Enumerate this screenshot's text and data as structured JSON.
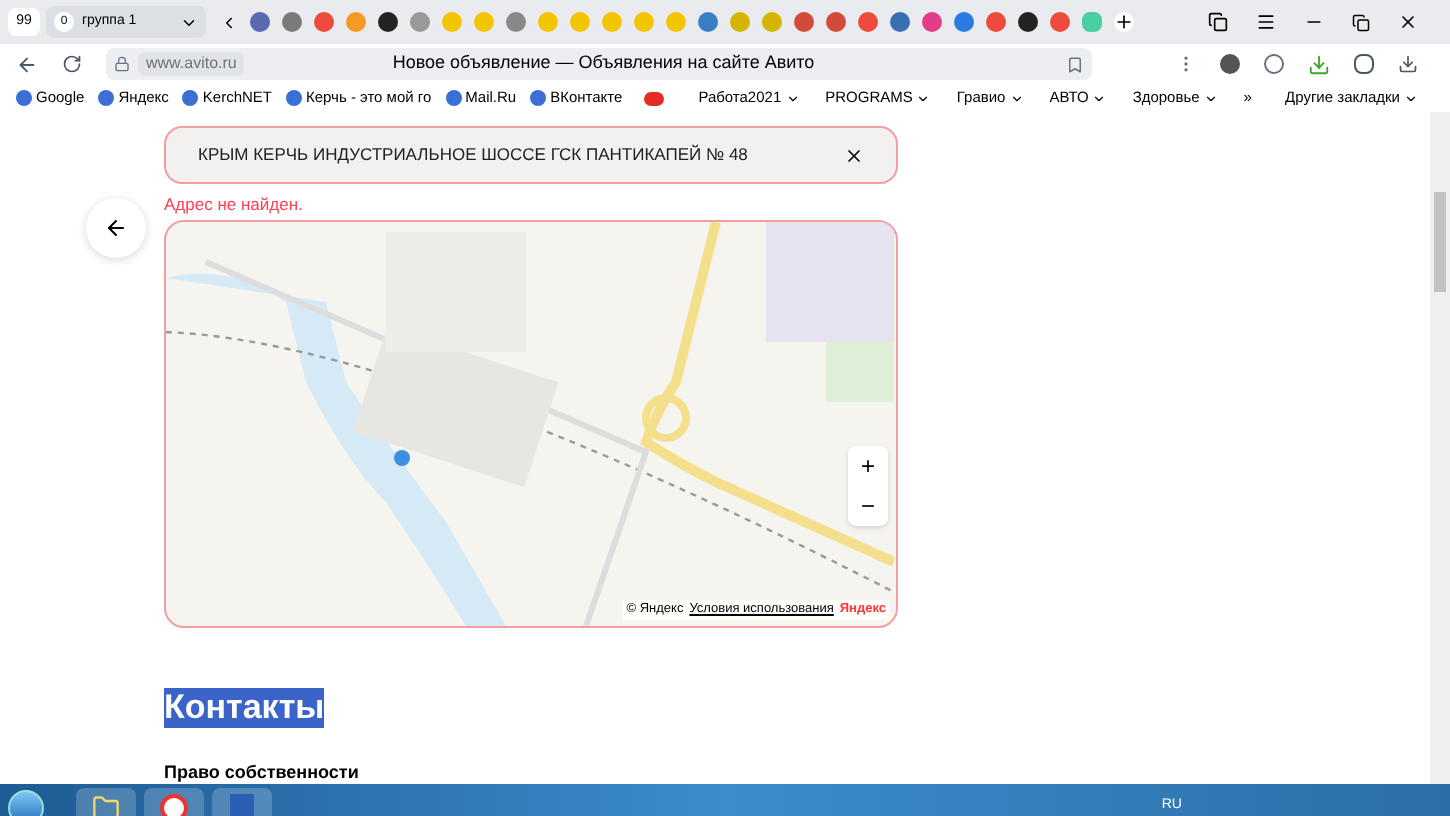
{
  "browser": {
    "tab_counter": "99",
    "tab_group": {
      "count": "0",
      "label": "группа 1"
    },
    "url": "www.avito.ru",
    "page_title": "Новое объявление — Объявления на сайте Авито"
  },
  "bookmarks": [
    {
      "label": "Google",
      "kind": "link"
    },
    {
      "label": "Яндекс",
      "kind": "link"
    },
    {
      "label": "KerchNET",
      "kind": "link"
    },
    {
      "label": "Керчь - это мой го",
      "kind": "link"
    },
    {
      "label": "Mail.Ru",
      "kind": "link"
    },
    {
      "label": "ВКонтакте",
      "kind": "link"
    },
    {
      "kind": "video"
    },
    {
      "label": "Работа2021",
      "kind": "folder"
    },
    {
      "label": "PROGRAMS",
      "kind": "folder"
    },
    {
      "label": "Гравио",
      "kind": "folder"
    },
    {
      "label": "АВТО",
      "kind": "folder"
    },
    {
      "label": "Здоровье",
      "kind": "folder"
    },
    {
      "label": "»",
      "kind": "more"
    },
    {
      "label": "Другие закладки",
      "kind": "folder"
    }
  ],
  "address_field": {
    "value": "КРЫМ  КЕРЧЬ ИНДУСТРИАЛЬНОЕ ШОССЕ ГСК ПАНТИКАПЕЙ № 48",
    "error": true,
    "error_text": "Адрес не найден."
  },
  "map": {
    "attribution": "© Яндекс",
    "terms_link": "Условия использования",
    "logo": "Яндекс",
    "zoom_in": "+",
    "zoom_out": "−"
  },
  "contacts": {
    "heading": "Контакты",
    "heading_selected": true,
    "subheading": "Право собственности"
  },
  "taskbar": {
    "language": "RU"
  }
}
